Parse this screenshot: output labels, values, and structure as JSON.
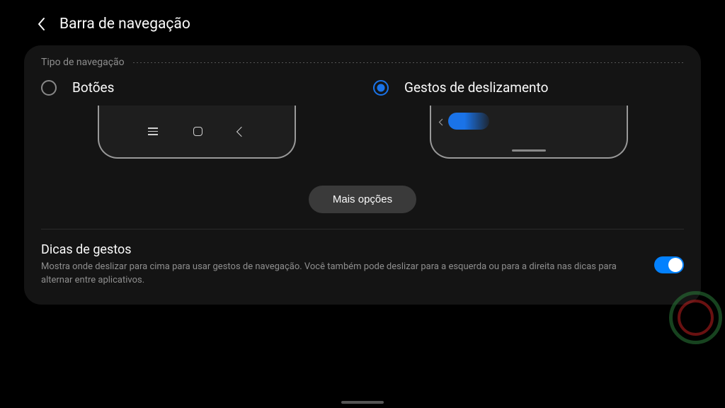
{
  "header": {
    "title": "Barra de navegação"
  },
  "section": {
    "label": "Tipo de navegação"
  },
  "options": {
    "buttons_label": "Botões",
    "gestures_label": "Gestos de deslizamento",
    "selected": "gestures"
  },
  "actions": {
    "more_options": "Mais opções"
  },
  "gesture_hints": {
    "title": "Dicas de gestos",
    "description": "Mostra onde deslizar para cima para usar gestos de navegação. Você também pode deslizar para a esquerda ou para a direita nas dicas para alternar entre aplicativos.",
    "enabled": true
  }
}
